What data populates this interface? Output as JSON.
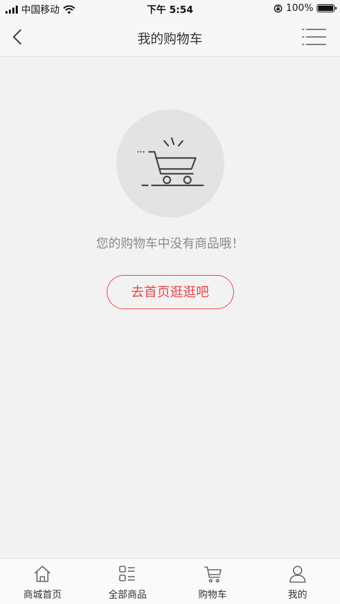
{
  "status_bar": {
    "carrier": "中国移动",
    "time": "下午 5:54",
    "battery": "100%",
    "battery_level": 1.0
  },
  "nav": {
    "title": "我的购物车",
    "back_icon": "chevron-left-icon",
    "menu_icon": "list-menu-icon"
  },
  "empty_state": {
    "icon": "shopping-cart-icon",
    "message": "您的购物车中没有商品哦！",
    "button_label": "去首页逛逛吧"
  },
  "colors": {
    "accent": "#e8474e",
    "background": "#f2f2f2",
    "icon_gray": "#555555"
  },
  "tab_bar": {
    "items": [
      {
        "label": "商城首页",
        "icon": "home-icon"
      },
      {
        "label": "全部商品",
        "icon": "category-list-icon"
      },
      {
        "label": "购物车",
        "icon": "cart-icon"
      },
      {
        "label": "我的",
        "icon": "user-icon"
      }
    ]
  }
}
